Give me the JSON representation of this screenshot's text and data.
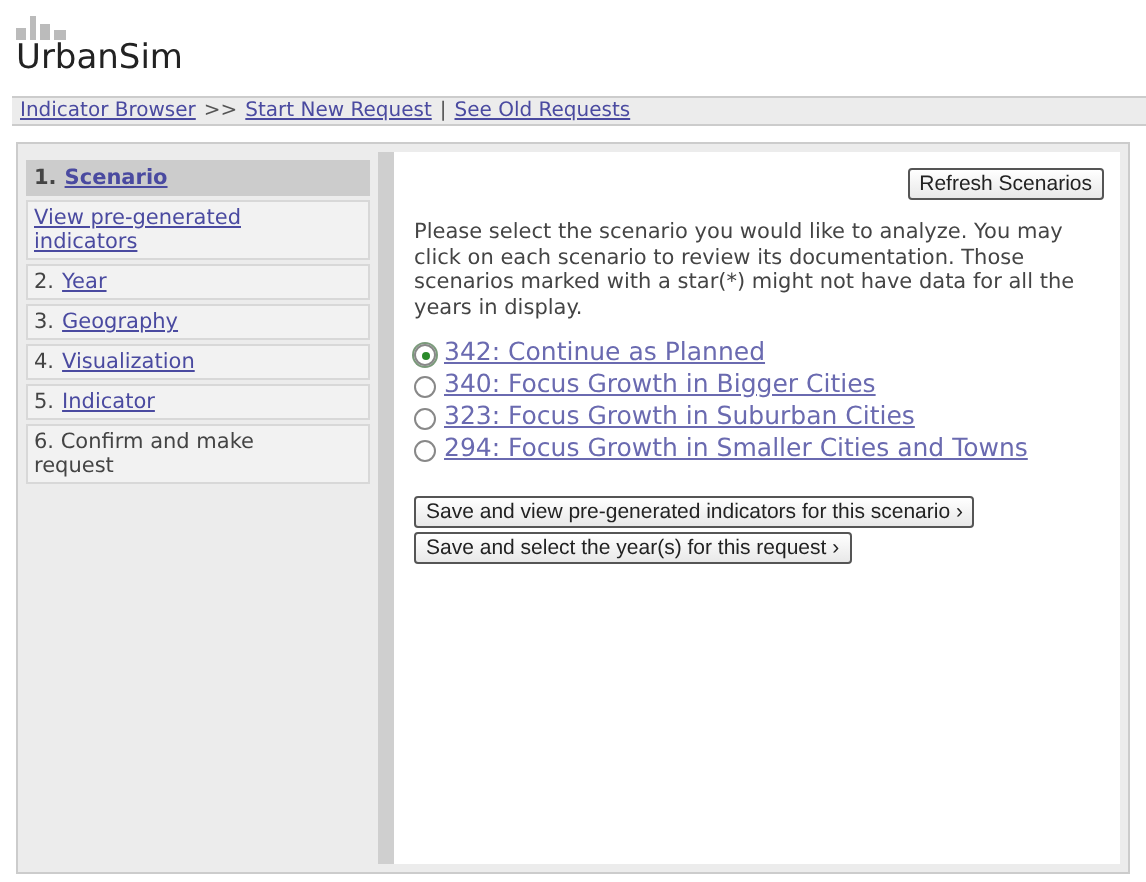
{
  "logo": {
    "text": "UrbanSim"
  },
  "breadcrumb": {
    "root": "Indicator Browser",
    "separator": ">>",
    "links": [
      "Start New Request",
      "See Old Requests"
    ],
    "divider": "|"
  },
  "steps": [
    {
      "number": "1.",
      "label": "Scenario",
      "link": true,
      "selected": true
    },
    {
      "label": "View pre-generated indicators",
      "link": true,
      "selected": false
    },
    {
      "number": "2.",
      "label": "Year",
      "link": true,
      "selected": false
    },
    {
      "number": "3.",
      "label": "Geography",
      "link": true,
      "selected": false
    },
    {
      "number": "4.",
      "label": "Visualization",
      "link": true,
      "selected": false
    },
    {
      "number": "5.",
      "label": "Indicator",
      "link": true,
      "selected": false
    },
    {
      "number": "6.",
      "label": "Confirm and make request",
      "link": false,
      "selected": false
    }
  ],
  "refresh_button": "Refresh Scenarios",
  "instructions": "Please select the scenario you would like to analyze. You may click on each scenario to review its documentation. Those scenarios marked with a star(*) might not have data for all the years in display.",
  "scenarios": [
    {
      "label": "342: Continue as Planned",
      "selected": true
    },
    {
      "label": "340: Focus Growth in Bigger Cities",
      "selected": false
    },
    {
      "label": "323: Focus Growth in Suburban Cities",
      "selected": false
    },
    {
      "label": "294: Focus Growth in Smaller Cities and Towns",
      "selected": false
    }
  ],
  "action_buttons": [
    "Save and view pre-generated indicators for this scenario ›",
    "Save and select the year(s) for this request ›"
  ]
}
